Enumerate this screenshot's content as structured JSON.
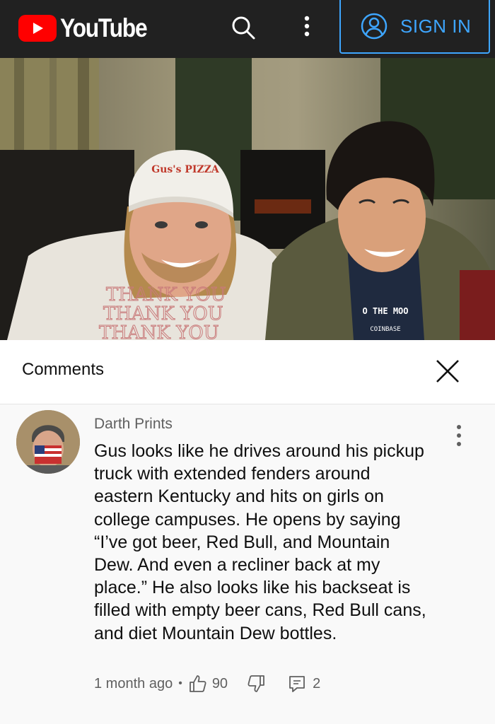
{
  "header": {
    "logo_text": "YouTube",
    "signin_label": "SIGN IN",
    "brand_color": "#ff0000",
    "accent_color": "#3ea6ff",
    "icons": [
      "youtube-logo-icon",
      "search-icon",
      "more-vert-icon",
      "account-circle-icon"
    ]
  },
  "video": {
    "cap_text": "Gus's PIZZA",
    "shirt_text": [
      "THANK YOU",
      "THANK YOU",
      "THANK YOU"
    ],
    "tshirt_text": "O THE MOO",
    "tshirt_sub": "COINBASE"
  },
  "comments": {
    "title": "Comments",
    "close_icon": "close-icon"
  },
  "comment": {
    "author": "Darth Prints",
    "text": "Gus looks like he drives around his pickup truck with extended fenders around eastern Kentucky and hits on girls on college campuses. He opens by saying “I’ve got beer, Red Bull, and Mountain Dew. And even a recliner back at my place.” He also looks like his backseat is filled with empty beer cans, Red Bull cans, and diet Mountain Dew bottles.",
    "time": "1 month ago",
    "separator": "•",
    "likes": "90",
    "replies": "2",
    "icons": [
      "thumb-up-icon",
      "thumb-down-icon",
      "reply-icon",
      "more-vert-icon"
    ]
  }
}
